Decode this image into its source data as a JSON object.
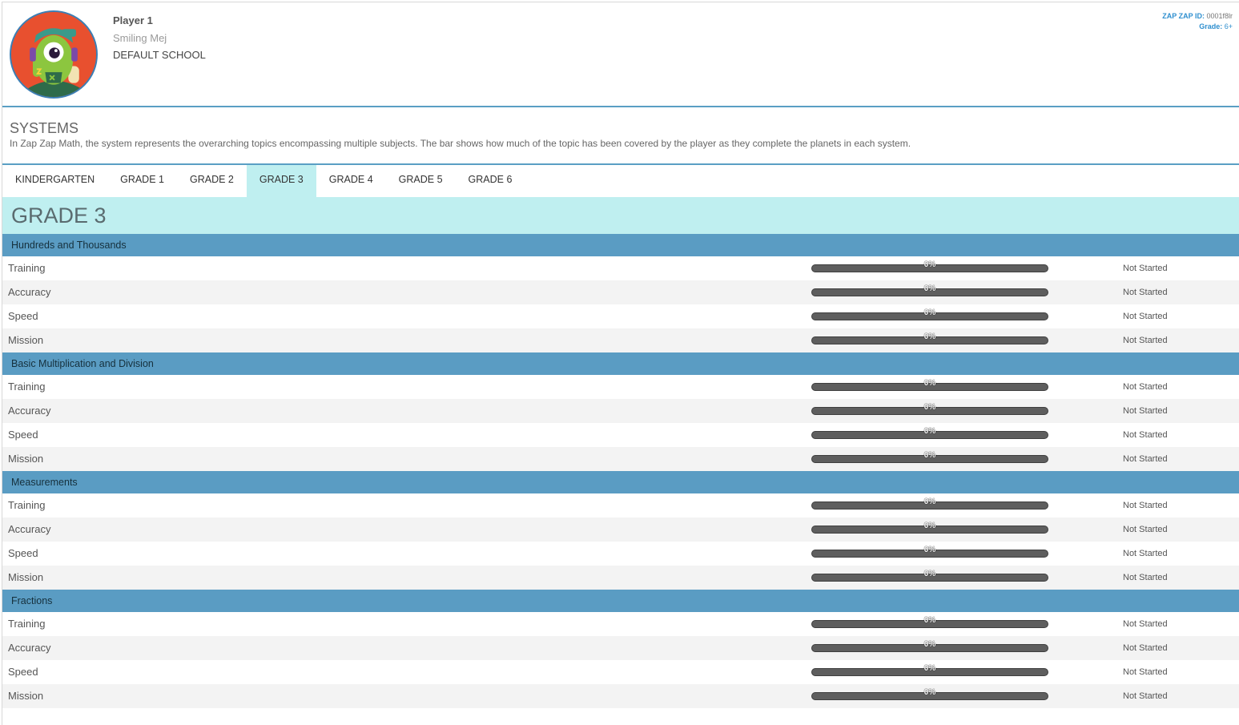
{
  "player": {
    "name": "Player 1",
    "nickname": "Smiling Mej",
    "school": "DEFAULT SCHOOL",
    "zap_id_label": "ZAP ZAP ID:",
    "zap_id_value": "0001f8lr",
    "grade_label": "Grade:",
    "grade_value": "6+",
    "avatar_icon": "green-one-eyed-alien-avatar"
  },
  "systems": {
    "title": "SYSTEMS",
    "description": "In Zap Zap Math, the system represents the overarching topics encompassing multiple subjects. The bar shows how much of the topic has been covered by the player as they complete the planets in each system."
  },
  "tabs": [
    {
      "label": "KINDERGARTEN",
      "active": false
    },
    {
      "label": "GRADE 1",
      "active": false
    },
    {
      "label": "GRADE 2",
      "active": false
    },
    {
      "label": "GRADE 3",
      "active": true
    },
    {
      "label": "GRADE 4",
      "active": false
    },
    {
      "label": "GRADE 5",
      "active": false
    },
    {
      "label": "GRADE 6",
      "active": false
    }
  ],
  "grade_title": "GRADE 3",
  "colors": {
    "accent": "#5a9cc3",
    "tab_active": "#bfeff0",
    "bar_track": "#5e5e5e",
    "bar_fill": "#7ac143"
  },
  "sections": [
    {
      "title": "Hundreds and Thousands",
      "rows": [
        {
          "label": "Training",
          "progress": 0,
          "progress_text": "0%",
          "status": "Not Started"
        },
        {
          "label": "Accuracy",
          "progress": 0,
          "progress_text": "0%",
          "status": "Not Started"
        },
        {
          "label": "Speed",
          "progress": 0,
          "progress_text": "0%",
          "status": "Not Started"
        },
        {
          "label": "Mission",
          "progress": 0,
          "progress_text": "0%",
          "status": "Not Started"
        }
      ]
    },
    {
      "title": "Basic Multiplication and Division",
      "rows": [
        {
          "label": "Training",
          "progress": 0,
          "progress_text": "0%",
          "status": "Not Started"
        },
        {
          "label": "Accuracy",
          "progress": 0,
          "progress_text": "0%",
          "status": "Not Started"
        },
        {
          "label": "Speed",
          "progress": 0,
          "progress_text": "0%",
          "status": "Not Started"
        },
        {
          "label": "Mission",
          "progress": 0,
          "progress_text": "0%",
          "status": "Not Started"
        }
      ]
    },
    {
      "title": "Measurements",
      "rows": [
        {
          "label": "Training",
          "progress": 0,
          "progress_text": "0%",
          "status": "Not Started"
        },
        {
          "label": "Accuracy",
          "progress": 0,
          "progress_text": "0%",
          "status": "Not Started"
        },
        {
          "label": "Speed",
          "progress": 0,
          "progress_text": "0%",
          "status": "Not Started"
        },
        {
          "label": "Mission",
          "progress": 0,
          "progress_text": "0%",
          "status": "Not Started"
        }
      ]
    },
    {
      "title": "Fractions",
      "rows": [
        {
          "label": "Training",
          "progress": 0,
          "progress_text": "0%",
          "status": "Not Started"
        },
        {
          "label": "Accuracy",
          "progress": 0,
          "progress_text": "0%",
          "status": "Not Started"
        },
        {
          "label": "Speed",
          "progress": 0,
          "progress_text": "0%",
          "status": "Not Started"
        },
        {
          "label": "Mission",
          "progress": 0,
          "progress_text": "0%",
          "status": "Not Started"
        }
      ]
    }
  ]
}
